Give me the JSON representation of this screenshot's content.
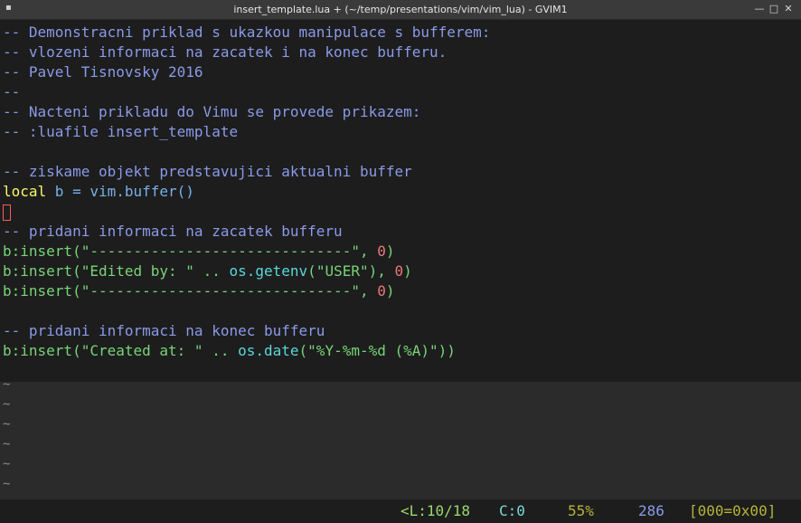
{
  "window": {
    "title": "insert_template.lua + (~/temp/presentations/vim/vim_lua) - GVIM1",
    "menu_glyph": "▪",
    "minimize_glyph": "—",
    "maximize_glyph": "□",
    "close_glyph": "✕"
  },
  "code": {
    "l1": "-- Demonstracni priklad s ukazkou manipulace s bufferem:",
    "l2": "-- vlozeni informaci na zacatek i na konec bufferu.",
    "l3": "-- Pavel Tisnovsky 2016",
    "l4": "--",
    "l5": "-- Nacteni prikladu do Vimu se provede prikazem:",
    "l6": "-- :luafile insert_template",
    "l8": "-- ziskame objekt predstavujici aktualni buffer",
    "l9_kw": "local",
    "l9_rest": " b = vim.buffer()",
    "l11": "-- pridani informaci na zacatek bufferu",
    "l12_call": "b:insert(",
    "l12_str": "\"------------------------------\"",
    "l12_sep": ", ",
    "l12_num": "0",
    "l12_end": ")",
    "l13_call": "b:insert(",
    "l13_str1": "\"Edited by: \"",
    "l13_op": " .. ",
    "l13_fn": "os.getenv",
    "l13_open": "(",
    "l13_str2": "\"USER\"",
    "l13_close": "), ",
    "l13_num": "0",
    "l13_end": ")",
    "l14_call": "b:insert(",
    "l14_str": "\"------------------------------\"",
    "l14_sep": ", ",
    "l14_num": "0",
    "l14_end": ")",
    "l16": "-- pridani informaci na konec bufferu",
    "l17_call": "b:insert(",
    "l17_str1": "\"Created at: \"",
    "l17_op": " .. ",
    "l17_fn": "os.date",
    "l17_open": "(",
    "l17_str2": "\"%Y-%m-%d (%A)\"",
    "l17_end": "))"
  },
  "tilde": "~",
  "status": {
    "position": "<L:10/18",
    "column": "C:0",
    "percent": "55%",
    "bytes": "286",
    "char_code": "[000=0x00]"
  },
  "colors": {
    "comment": "#8a9ae8",
    "keyword": "#f8f86a",
    "string": "#78d478",
    "number": "#e87878",
    "background": "#1d1d1d"
  }
}
